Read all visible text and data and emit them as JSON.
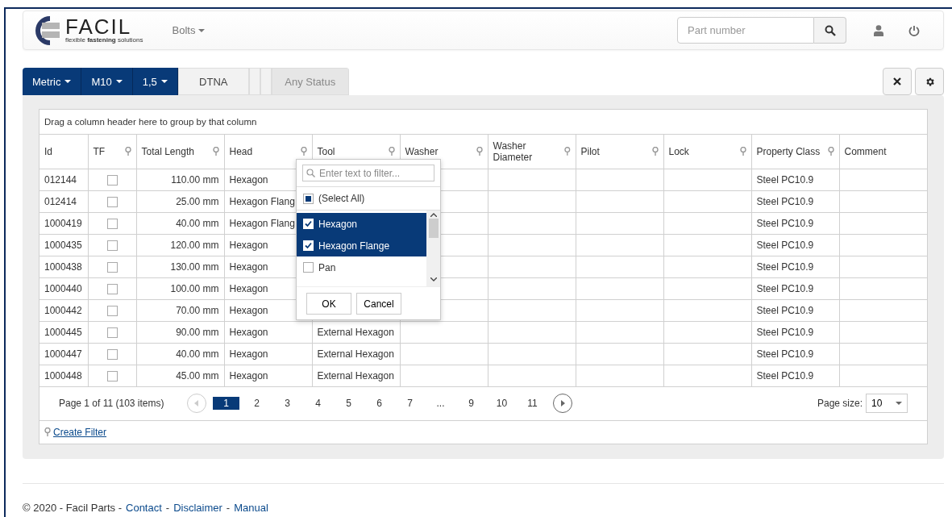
{
  "header": {
    "logo": {
      "name": "FACIL",
      "tagline": "flexible **fastening** solutions"
    },
    "menu": "Bolts",
    "search": {
      "placeholder": "Part number"
    }
  },
  "toolbar": {
    "dropdowns": [
      {
        "label": "Metric"
      },
      {
        "label": "M10"
      },
      {
        "label": "1,5"
      }
    ],
    "button": "DTNA",
    "status": "Any Status"
  },
  "grid": {
    "group_hint": "Drag a column header here to group by that column",
    "columns": [
      {
        "label": "Id",
        "filterable": false
      },
      {
        "label": "TF",
        "filterable": true
      },
      {
        "label": "Total Length",
        "filterable": true
      },
      {
        "label": "Head",
        "filterable": true
      },
      {
        "label": "Tool",
        "filterable": true
      },
      {
        "label": "Washer",
        "filterable": true
      },
      {
        "label": "Washer Diameter",
        "filterable": true
      },
      {
        "label": "Pilot",
        "filterable": true
      },
      {
        "label": "Lock",
        "filterable": true
      },
      {
        "label": "Property Class",
        "filterable": true
      },
      {
        "label": "Comment",
        "filterable": false
      }
    ],
    "rows": [
      {
        "id": "012144",
        "tf": false,
        "total_length": "110.00 mm",
        "head": "Hexagon",
        "property_class": "Steel PC10.9"
      },
      {
        "id": "012414",
        "tf": false,
        "total_length": "25.00 mm",
        "head": "Hexagon Flang",
        "property_class": "Steel PC10.9"
      },
      {
        "id": "1000419",
        "tf": false,
        "total_length": "40.00 mm",
        "head": "Hexagon Flang",
        "property_class": "Steel PC10.9"
      },
      {
        "id": "1000435",
        "tf": false,
        "total_length": "120.00 mm",
        "head": "Hexagon",
        "property_class": "Steel PC10.9"
      },
      {
        "id": "1000438",
        "tf": false,
        "total_length": "130.00 mm",
        "head": "Hexagon",
        "property_class": "Steel PC10.9"
      },
      {
        "id": "1000440",
        "tf": false,
        "total_length": "100.00 mm",
        "head": "Hexagon",
        "property_class": "Steel PC10.9"
      },
      {
        "id": "1000442",
        "tf": false,
        "total_length": "70.00 mm",
        "head": "Hexagon",
        "property_class": "Steel PC10.9"
      },
      {
        "id": "1000445",
        "tf": false,
        "total_length": "90.00 mm",
        "head": "Hexagon",
        "tool": "External Hexagon",
        "property_class": "Steel PC10.9"
      },
      {
        "id": "1000447",
        "tf": false,
        "total_length": "40.00 mm",
        "head": "Hexagon",
        "tool": "External Hexagon",
        "property_class": "Steel PC10.9"
      },
      {
        "id": "1000448",
        "tf": false,
        "total_length": "45.00 mm",
        "head": "Hexagon",
        "tool": "External Hexagon",
        "property_class": "Steel PC10.9"
      }
    ],
    "filter_popup": {
      "placeholder": "Enter text to filter...",
      "select_all": {
        "label": "(Select All)",
        "indeterminate": true
      },
      "items": [
        {
          "label": "Hexagon",
          "checked": true,
          "selected": true
        },
        {
          "label": "Hexagon Flange",
          "checked": true,
          "selected": true
        },
        {
          "label": "Pan",
          "checked": false,
          "selected": false
        }
      ],
      "buttons": [
        "OK",
        "Cancel"
      ]
    },
    "pager": {
      "summary": "Page 1 of 11 (103 items)",
      "pages": [
        {
          "label": "1",
          "selected": true
        },
        {
          "label": "2",
          "selected": false
        },
        {
          "label": "3",
          "selected": false
        },
        {
          "label": "4",
          "selected": false
        },
        {
          "label": "5",
          "selected": false
        },
        {
          "label": "6",
          "selected": false
        },
        {
          "label": "7",
          "selected": false
        },
        {
          "label": "...",
          "selected": false
        },
        {
          "label": "9",
          "selected": false
        },
        {
          "label": "10",
          "selected": false
        },
        {
          "label": "11",
          "selected": false
        }
      ],
      "page_size_label": "Page size:",
      "page_size": "10"
    },
    "create_filter": "Create Filter"
  },
  "footer": [
    {
      "kind": "text",
      "text": "© 2020 - Facil Parts -"
    },
    {
      "kind": "link",
      "text": "Contact"
    },
    {
      "kind": "text",
      "text": "-"
    },
    {
      "kind": "link",
      "text": "Disclaimer"
    },
    {
      "kind": "text",
      "text": "-"
    },
    {
      "kind": "link",
      "text": "Manual"
    }
  ]
}
